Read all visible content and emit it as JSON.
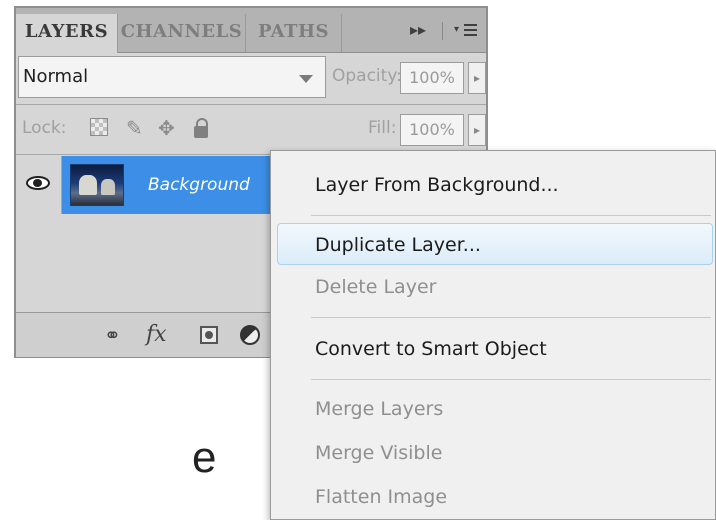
{
  "panel": {
    "tabs": [
      "LAYERS",
      "CHANNELS",
      "PATHS"
    ],
    "panel_menu_glyph": "▸▸",
    "blend_mode": "Normal",
    "opacity_label": "Opacity:",
    "opacity_value": "100%",
    "lock_label": "Lock:",
    "fill_label": "Fill:",
    "fill_value": "100%",
    "layer": {
      "name": "Background",
      "visible": true
    },
    "bottom_icons": [
      "link-icon",
      "fx-icon",
      "layer-mask-icon",
      "adjustment-layer-icon"
    ],
    "fx_label": "fx"
  },
  "context_menu": {
    "items": [
      {
        "label": "Layer From Background...",
        "enabled": true
      },
      {
        "label": "Duplicate Layer...",
        "enabled": true,
        "highlighted": true
      },
      {
        "label": "Delete Layer",
        "enabled": false
      },
      {
        "label": "Convert to Smart Object",
        "enabled": true
      },
      {
        "label": "Merge Layers",
        "enabled": false
      },
      {
        "label": "Merge Visible",
        "enabled": false
      },
      {
        "label": "Flatten Image",
        "enabled": false
      }
    ]
  },
  "background_fragment": "e",
  "colors": {
    "selection_blue": "#3d8ee6",
    "panel_gray": "#d6d6d6",
    "menu_bg": "#f0f0f0",
    "menu_highlight_border": "#a8d2ee"
  }
}
